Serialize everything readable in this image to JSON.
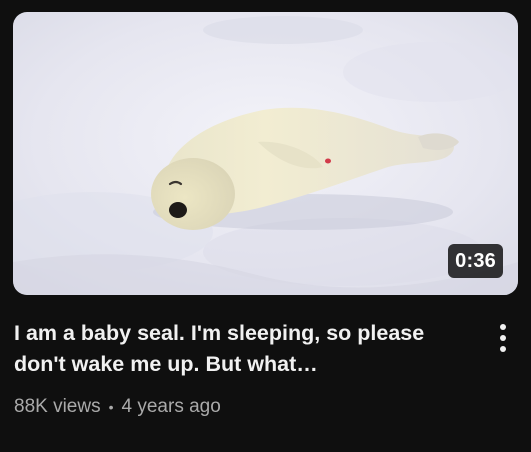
{
  "video": {
    "duration": "0:36",
    "title": "I am a baby seal. I'm sleeping, so please don't wake me up. But what…",
    "views": "88K views",
    "separator": "•",
    "age": "4 years ago",
    "thumbnail_subject": "baby seal sleeping on snow"
  },
  "icons": {
    "menu": "more-vert-icon"
  },
  "colors": {
    "background": "#0f0f0f",
    "title": "#f1f1f1",
    "secondary_text": "#aaaaaa",
    "duration_badge": "#000000"
  }
}
